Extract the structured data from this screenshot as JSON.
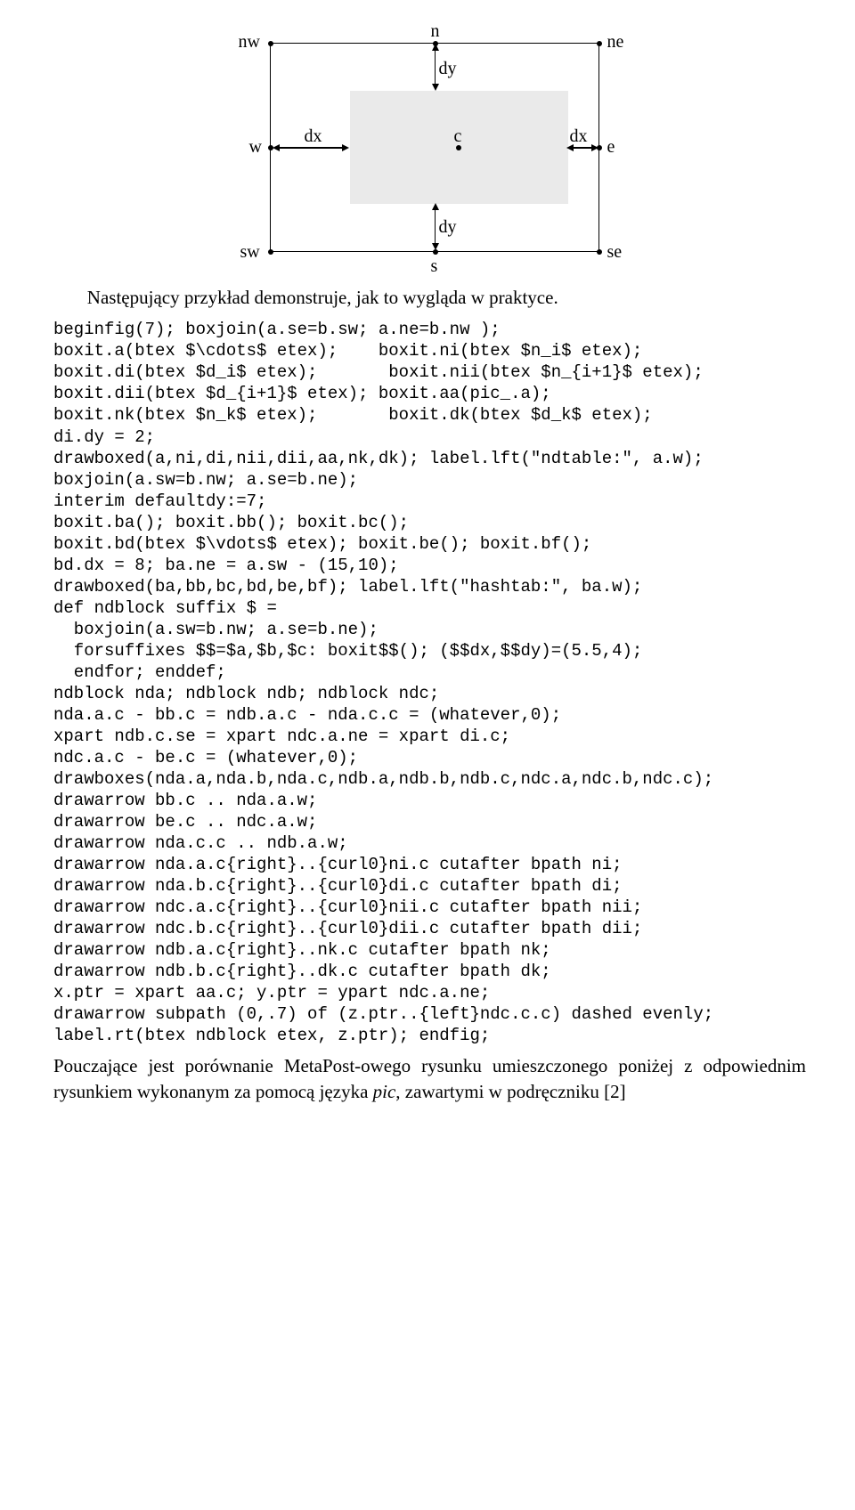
{
  "figure": {
    "labels": {
      "nw": "nw",
      "n": "n",
      "ne": "ne",
      "w": "w",
      "c": "c",
      "e": "e",
      "sw": "sw",
      "s": "s",
      "se": "se",
      "dx_left": "dx",
      "dx_right": "dx",
      "dy_top": "dy",
      "dy_bottom": "dy"
    }
  },
  "para1": "Następujący przykład demonstruje, jak to wygląda w praktyce.",
  "code": {
    "lines": [
      "beginfig(7); boxjoin(a.se=b.sw; a.ne=b.nw );",
      "boxit.a(btex $\\cdots$ etex);    boxit.ni(btex $n_i$ etex);",
      "boxit.di(btex $d_i$ etex);       boxit.nii(btex $n_{i+1}$ etex);",
      "boxit.dii(btex $d_{i+1}$ etex); boxit.aa(pic_.a);",
      "boxit.nk(btex $n_k$ etex);       boxit.dk(btex $d_k$ etex);",
      "di.dy = 2;",
      "drawboxed(a,ni,di,nii,dii,aa,nk,dk); label.lft(\"ndtable:\", a.w);",
      "boxjoin(a.sw=b.nw; a.se=b.ne);",
      "interim defaultdy:=7;",
      "boxit.ba(); boxit.bb(); boxit.bc();",
      "boxit.bd(btex $\\vdots$ etex); boxit.be(); boxit.bf();",
      "bd.dx = 8; ba.ne = a.sw - (15,10);",
      "drawboxed(ba,bb,bc,bd,be,bf); label.lft(\"hashtab:\", ba.w);",
      "def ndblock suffix $ =",
      "  boxjoin(a.sw=b.nw; a.se=b.ne);",
      "  forsuffixes $$=$a,$b,$c: boxit$$(); ($$dx,$$dy)=(5.5,4);",
      "  endfor; enddef;",
      "ndblock nda; ndblock ndb; ndblock ndc;",
      "nda.a.c - bb.c = ndb.a.c - nda.c.c = (whatever,0);",
      "xpart ndb.c.se = xpart ndc.a.ne = xpart di.c;",
      "ndc.a.c - be.c = (whatever,0);",
      "drawboxes(nda.a,nda.b,nda.c,ndb.a,ndb.b,ndb.c,ndc.a,ndc.b,ndc.c);",
      "drawarrow bb.c .. nda.a.w;",
      "drawarrow be.c .. ndc.a.w;",
      "drawarrow nda.c.c .. ndb.a.w;",
      "drawarrow nda.a.c{right}..{curl0}ni.c cutafter bpath ni;",
      "drawarrow nda.b.c{right}..{curl0}di.c cutafter bpath di;",
      "drawarrow ndc.a.c{right}..{curl0}nii.c cutafter bpath nii;",
      "drawarrow ndc.b.c{right}..{curl0}dii.c cutafter bpath dii;",
      "drawarrow ndb.a.c{right}..nk.c cutafter bpath nk;",
      "drawarrow ndb.b.c{right}..dk.c cutafter bpath dk;",
      "x.ptr = xpart aa.c; y.ptr = ypart ndc.a.ne;",
      "drawarrow subpath (0,.7) of (z.ptr..{left}ndc.c.c) dashed evenly;",
      "label.rt(btex ndblock etex, z.ptr); endfig;"
    ]
  },
  "para2_parts": {
    "a": "Pouczające jest porównanie MetaPost-owego rysunku umieszczonego poniżej z odpowiednim rysunkiem wykonanym za pomocą języka ",
    "b": "pic",
    "c": ", zawartymi w pod­ręczniku [2]"
  }
}
